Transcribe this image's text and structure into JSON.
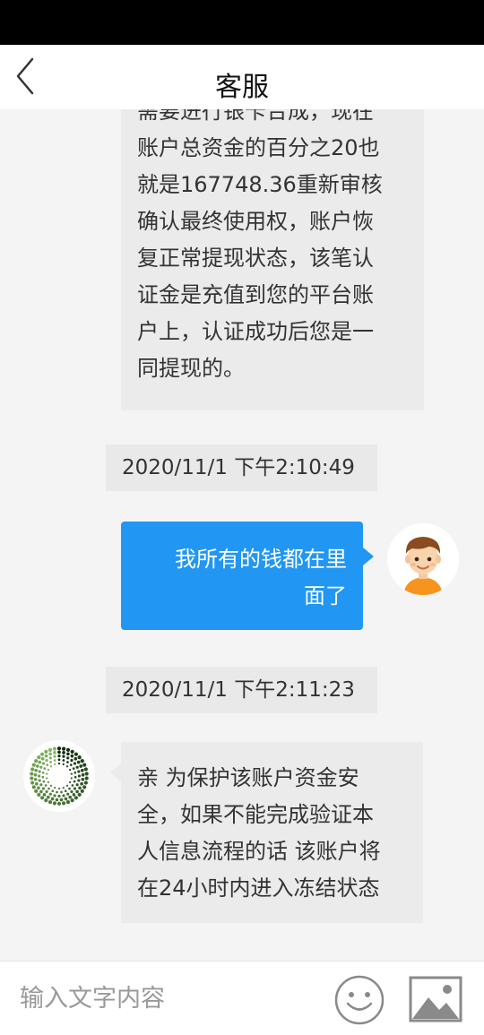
{
  "header": {
    "title": "客服",
    "back_icon": "chevron-left-icon"
  },
  "messages": [
    {
      "id": "msg1",
      "side": "left",
      "lines_partial_top": "需要进行银卡合成，现在",
      "lines": [
        "账户总资金的百分之20也",
        "就是167748.36重新审核",
        "确认最终使用权，账户恢",
        "复正常提现状态，该笔认",
        "证金是充值到您的平台账",
        "户上，认证成功后您是一",
        "同提现的。"
      ]
    },
    {
      "id": "ts1",
      "timestamp": "2020/11/1 下午2:10:49"
    },
    {
      "id": "msg2",
      "side": "right",
      "lines": [
        "我所有的钱都在里",
        "面了"
      ]
    },
    {
      "id": "ts2",
      "timestamp": "2020/11/1 下午2:11:23"
    },
    {
      "id": "msg3",
      "side": "left",
      "lines": [
        "亲 为保护该账户资金安",
        "全，如果不能完成验证本",
        "人信息流程的话 该账户将",
        "在24小时内进入冻结状态"
      ]
    }
  ],
  "input": {
    "placeholder": "输入文字内容",
    "value": "",
    "emoji_icon": "smiley-icon",
    "image_icon": "image-icon"
  },
  "colors": {
    "status_bar": "#000000",
    "chat_background": "#f4f4f4",
    "incoming_bubble": "#ebebeb",
    "outgoing_bubble": "#2196f3",
    "outgoing_text": "#ffffff"
  }
}
